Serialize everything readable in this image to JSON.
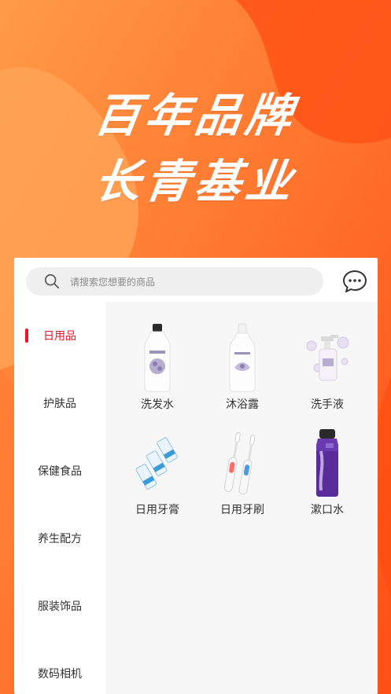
{
  "hero": {
    "line1": "百年品牌",
    "line2": "长青基业"
  },
  "search": {
    "placeholder": "请搜索您想要的商品"
  },
  "sidebar": {
    "items": [
      {
        "label": "日用品",
        "active": true
      },
      {
        "label": "护肤品",
        "active": false
      },
      {
        "label": "保健食品",
        "active": false
      },
      {
        "label": "养生配方",
        "active": false
      },
      {
        "label": "服装饰品",
        "active": false
      },
      {
        "label": "数码相机",
        "active": false
      }
    ]
  },
  "products": [
    {
      "name": "洗发水",
      "icon": "shampoo-bottle-icon"
    },
    {
      "name": "沐浴露",
      "icon": "body-wash-bottle-icon"
    },
    {
      "name": "洗手液",
      "icon": "hand-soap-bottle-icon"
    },
    {
      "name": "日用牙膏",
      "icon": "toothpaste-tubes-icon"
    },
    {
      "name": "日用牙刷",
      "icon": "electric-toothbrush-icon"
    },
    {
      "name": "漱口水",
      "icon": "mouthwash-bottle-icon"
    }
  ],
  "colors": {
    "accent": "#e8162b",
    "background_orange": "#ff6a2a",
    "background_light": "#ff9a4a"
  }
}
